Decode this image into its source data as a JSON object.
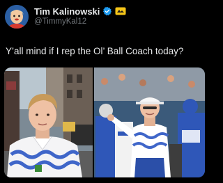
{
  "author": {
    "display_name": "Tim Kalinowski",
    "handle": "@TimmyKal12",
    "verified_color": "#1d9bf0",
    "affiliation_badge_color": "#f5c518",
    "avatar_icon": "cartoon-avatar"
  },
  "tweet": {
    "text": "Y’all mind if I rep the Ol’ Ball Coach today?"
  },
  "media": {
    "photos": [
      {
        "name": "selfie-photo",
        "description_icon": "photo"
      },
      {
        "name": "coach-photo",
        "description_icon": "photo"
      }
    ]
  }
}
